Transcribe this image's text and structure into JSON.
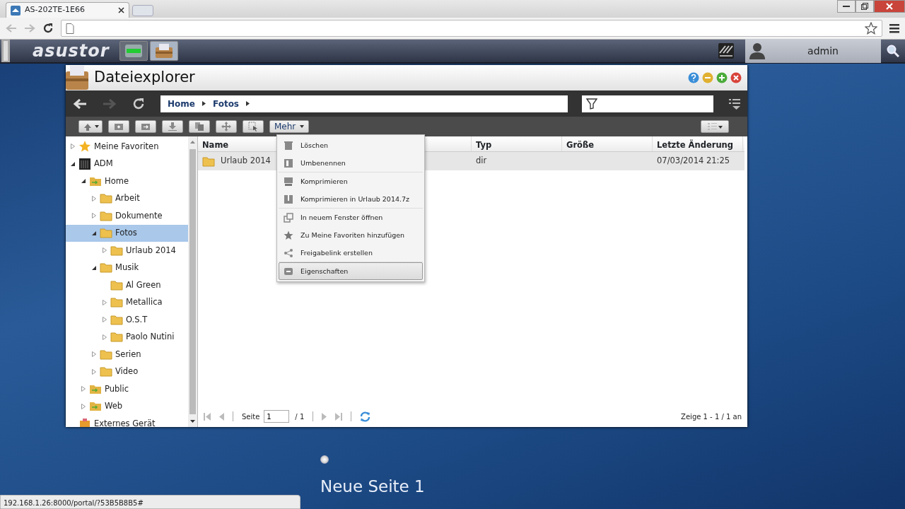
{
  "browser": {
    "tab_title": "AS-202TE-1E66",
    "status_url": "192.168.1.26:8000/portal/?53B5B8B5#"
  },
  "topbar": {
    "logo": "asustor",
    "user": "admin"
  },
  "window": {
    "title": "Dateiexplorer",
    "breadcrumb": [
      "Home",
      "Fotos"
    ],
    "toolbar_more": "Mehr"
  },
  "tree": [
    {
      "label": "Meine Favoriten",
      "kind": "favorites",
      "expanded": false,
      "selected": false
    },
    {
      "label": "ADM",
      "kind": "device",
      "expanded": true,
      "selected": false,
      "children": [
        {
          "label": "Home",
          "kind": "share",
          "expanded": true,
          "selected": false,
          "children": [
            {
              "label": "Arbeit",
              "kind": "folder",
              "expanded": false,
              "selected": false
            },
            {
              "label": "Dokumente",
              "kind": "folder",
              "expanded": false,
              "selected": false
            },
            {
              "label": "Fotos",
              "kind": "folder",
              "expanded": true,
              "selected": true,
              "children": [
                {
                  "label": "Urlaub 2014",
                  "kind": "folder",
                  "expanded": false,
                  "selected": false
                }
              ]
            },
            {
              "label": "Musik",
              "kind": "folder",
              "expanded": true,
              "selected": false,
              "children": [
                {
                  "label": "Al Green",
                  "kind": "folder",
                  "selected": false
                },
                {
                  "label": "Metallica",
                  "kind": "folder",
                  "expanded": false,
                  "selected": false
                },
                {
                  "label": "O.S.T",
                  "kind": "folder",
                  "expanded": false,
                  "selected": false
                },
                {
                  "label": "Paolo Nutini",
                  "kind": "folder",
                  "expanded": false,
                  "selected": false
                }
              ]
            },
            {
              "label": "Serien",
              "kind": "folder",
              "expanded": false,
              "selected": false
            },
            {
              "label": "Video",
              "kind": "folder",
              "expanded": false,
              "selected": false
            }
          ]
        },
        {
          "label": "Public",
          "kind": "share",
          "expanded": false,
          "selected": false
        },
        {
          "label": "Web",
          "kind": "share",
          "expanded": false,
          "selected": false
        }
      ]
    },
    {
      "label": "Externes Gerät",
      "kind": "external",
      "selected": false
    }
  ],
  "table": {
    "columns": [
      "Name",
      "Typ",
      "Größe",
      "Letzte Änderung"
    ],
    "rows": [
      {
        "name": "Urlaub 2014",
        "type": "dir",
        "modified": "07/03/2014 21:25",
        "selected": true
      }
    ]
  },
  "context_menu": {
    "groups": [
      [
        {
          "label": "Löschen",
          "selected": false
        },
        {
          "label": "Umbenennen",
          "selected": false
        }
      ],
      [
        {
          "label": "Komprimieren",
          "selected": false
        },
        {
          "label": "Komprimieren in Urlaub 2014.7z",
          "selected": false
        }
      ],
      [
        {
          "label": "In neuem Fenster öffnen",
          "selected": false
        },
        {
          "label": "Zu Meine Favoriten hinzufügen",
          "selected": false
        },
        {
          "label": "Freigabelink erstellen",
          "selected": false
        }
      ],
      [
        {
          "label": "Eigenschaften",
          "selected": true
        }
      ]
    ]
  },
  "pager": {
    "page_label": "Seite",
    "page_value": "1",
    "page_total": "/ 1",
    "summary": "Zeige 1 - 1 / 1 an"
  },
  "desktop": {
    "pages": [
      {
        "selected": true
      }
    ],
    "page_title": "Neue Seite 1"
  }
}
